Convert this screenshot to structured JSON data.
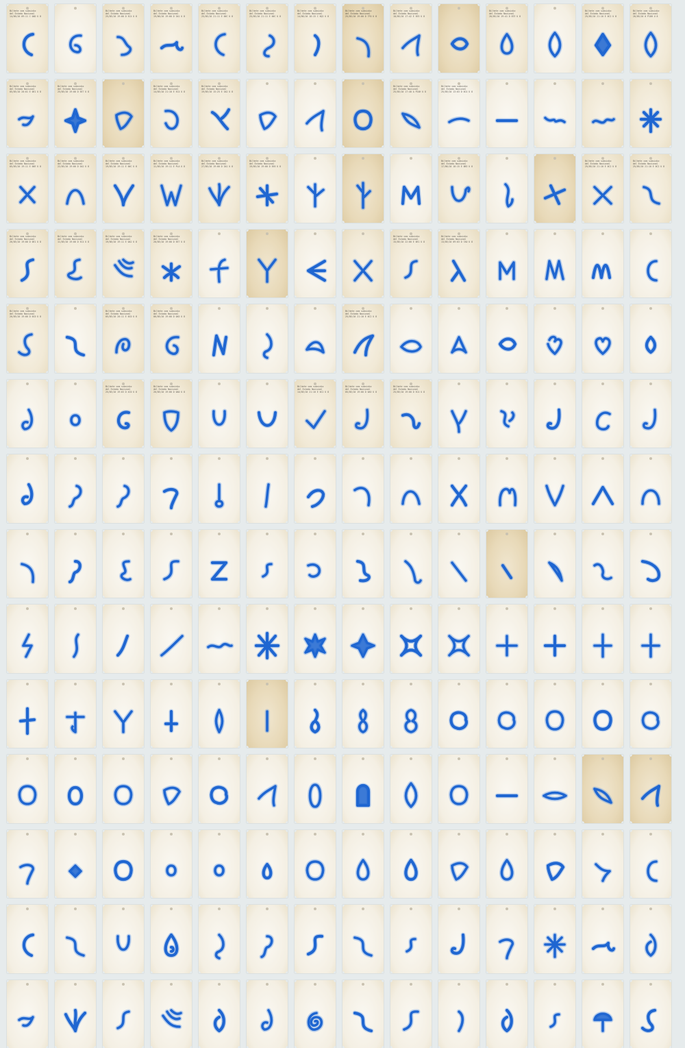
{
  "palette": {
    "background": "#e6ebec",
    "ink": "#1f66d1",
    "ink_light": "#4a8ae6",
    "paper": "#f3ecdc"
  },
  "print": {
    "line1": "Bilhete com subsidio",
    "line2": "del Estado Nacional"
  },
  "layout": {
    "columns": 14,
    "rows": 14
  },
  "tickets": [
    {
      "l3": "14/06/10 09:11 C 0AD  U 8",
      "shape": "c-shape",
      "tone": "normal"
    },
    {
      "l3": "",
      "shape": "g-curl",
      "tone": "pale"
    },
    {
      "l3": "25/05/10 19:00 D 5C4  U 8",
      "shape": "wave-squiggle",
      "tone": "normal"
    },
    {
      "l3": "19/06/10 19:00 D 3A1  U 8",
      "shape": "bird",
      "tone": "normal"
    },
    {
      "l3": "25/05/10 21:11 E 00C  U 8",
      "shape": "c-shape",
      "tone": "normal"
    },
    {
      "l3": "25/05/10 21:11 E 00C  U 8",
      "shape": "hook",
      "tone": "normal"
    },
    {
      "l3": "14/06/10 18:15 C 6Q2  U 8",
      "shape": "seed",
      "tone": "normal"
    },
    {
      "l3": "25/05/10 19:00 D 7F0  U 8",
      "shape": "hook-down",
      "tone": "aged"
    },
    {
      "l3": "18/05/10 17:42 E 5E5  U 8",
      "shape": "fin",
      "tone": "normal"
    },
    {
      "l3": "",
      "shape": "blob-wide",
      "tone": "aged"
    },
    {
      "l3": "26/05/10 19:41 D 87E  U 8",
      "shape": "drop",
      "tone": "normal"
    },
    {
      "l3": "",
      "shape": "leaf",
      "tone": "pale"
    },
    {
      "l3": "25/05/10 21:10 E 0C2  U 8",
      "shape": "diamond",
      "tone": "normal"
    },
    {
      "l3": "26/05/10 0 P18H  U 8",
      "shape": "leaf",
      "tone": "normal"
    },
    {
      "l3": "05/05/10 20:01 E 0E1  U 8",
      "shape": "bird-small",
      "tone": "normal"
    },
    {
      "l3": "25/05/10 19:00 D 5E7  U 8",
      "shape": "star4",
      "tone": "normal"
    },
    {
      "l3": "",
      "shape": "blob-tri",
      "tone": "aged"
    },
    {
      "l3": "14/05/10 21:10 E 5C4  U 8",
      "shape": "ghost",
      "tone": "normal"
    },
    {
      "l3": "19/05/10 15:25 E 3A2  U 8",
      "shape": "bird-curl",
      "tone": "normal"
    },
    {
      "l3": "",
      "shape": "blob-tri",
      "tone": "pale"
    },
    {
      "l3": "",
      "shape": "fin",
      "tone": "pale"
    },
    {
      "l3": "",
      "shape": "blob-round",
      "tone": "aged"
    },
    {
      "l3": "25/05/10 17:40 A P24H  U 8",
      "shape": "fin-right",
      "tone": "normal"
    },
    {
      "l3": "25/05/10 13:03 D 0C4  U 8",
      "shape": "dash-curve",
      "tone": "pale"
    },
    {
      "l3": "",
      "shape": "dash-flat",
      "tone": "pale"
    },
    {
      "l3": "",
      "shape": "bow",
      "tone": "pale"
    },
    {
      "l3": "",
      "shape": "wave-flat",
      "tone": "normal"
    },
    {
      "l3": "",
      "shape": "star-burst",
      "tone": "normal"
    },
    {
      "l3": "05/05/10 19:11 E 00E  U 8",
      "shape": "x-blob",
      "tone": "normal"
    },
    {
      "l3": "22/05/10 19:00 D 5A2  U 8",
      "shape": "arch",
      "tone": "normal"
    },
    {
      "l3": "19/05/10 19:11 E 00C  U 8",
      "shape": "wing-v",
      "tone": "normal"
    },
    {
      "l3": "11/05/10 19:11 E PLA  U 8",
      "shape": "w-shape",
      "tone": "normal"
    },
    {
      "l3": "27/05/10 19:00 D 3A1  U 8",
      "shape": "wings-up",
      "tone": "normal"
    },
    {
      "l3": "19/05/10 19:00 D 5E6  U 8",
      "shape": "starfish",
      "tone": "normal"
    },
    {
      "l3": "",
      "shape": "branch",
      "tone": "pale"
    },
    {
      "l3": "",
      "shape": "branch-tall",
      "tone": "aged"
    },
    {
      "l3": "",
      "shape": "crown",
      "tone": "pale"
    },
    {
      "l3": "17/06/10 18:15 E 0B3  U 8",
      "shape": "u-hook",
      "tone": "normal"
    },
    {
      "l3": "",
      "shape": "hook-tall",
      "tone": "pale"
    },
    {
      "l3": "",
      "shape": "arrow-cross",
      "tone": "aged"
    },
    {
      "l3": "25/05/10 21:10 E 0C2  U 8",
      "shape": "x-cross",
      "tone": "normal"
    },
    {
      "l3": "25/05/10 21:10 E 0C2  U 8",
      "shape": "twist",
      "tone": "normal"
    },
    {
      "l3": "26/05/10 19:00 D 0E1  U 8",
      "shape": "s-curl",
      "tone": "normal"
    },
    {
      "l3": "11/05/10 19:00 D 5C4  U 8",
      "shape": "s-loop",
      "tone": "normal"
    },
    {
      "l3": "19/06/10 19:11 E 0A2  U 8",
      "shape": "claw",
      "tone": "normal"
    },
    {
      "l3": "20/05/10 19:00 D 5E7  U 8",
      "shape": "octopus",
      "tone": "normal"
    },
    {
      "l3": "",
      "shape": "f-shape",
      "tone": "pale"
    },
    {
      "l3": "",
      "shape": "y-branch",
      "tone": "aged"
    },
    {
      "l3": "",
      "shape": "arrow-left",
      "tone": "pale"
    },
    {
      "l3": "",
      "shape": "wings-x",
      "tone": "normal"
    },
    {
      "l3": "15/05/10 22:00 E 0E1  U 8",
      "shape": "s-hook",
      "tone": "normal"
    },
    {
      "l3": "13/05/10 09:03 D 7A0  U 8",
      "shape": "lambda",
      "tone": "normal"
    },
    {
      "l3": "",
      "shape": "m-shape",
      "tone": "pale"
    },
    {
      "l3": "",
      "shape": "n-double",
      "tone": "pale"
    },
    {
      "l3": "",
      "shape": "m-wave",
      "tone": "pale"
    },
    {
      "l3": "",
      "shape": "hook-c",
      "tone": "pale"
    },
    {
      "l3": "26/05/10 19:00 D 0C0  U 8",
      "shape": "swan",
      "tone": "normal"
    },
    {
      "l3": "",
      "shape": "wave-s",
      "tone": "pale"
    },
    {
      "l3": "05/05/10 20:11 E 0C0  U 8",
      "shape": "loop",
      "tone": "normal"
    },
    {
      "l3": "06/05/10 19:00 D 0A5  U 8",
      "shape": "spiral-c",
      "tone": "normal"
    },
    {
      "l3": "",
      "shape": "n-zig",
      "tone": "pale"
    },
    {
      "l3": "",
      "shape": "drop-tail",
      "tone": "pale"
    },
    {
      "l3": "",
      "shape": "foot",
      "tone": "pale"
    },
    {
      "l3": "25/05/10 21:10 E 0C2  U 8",
      "shape": "boomerang",
      "tone": "normal"
    },
    {
      "l3": "",
      "shape": "fish",
      "tone": "pale"
    },
    {
      "l3": "",
      "shape": "arrow-tip",
      "tone": "pale"
    },
    {
      "l3": "",
      "shape": "blob-wide",
      "tone": "pale"
    },
    {
      "l3": "",
      "shape": "blob-heart",
      "tone": "pale"
    },
    {
      "l3": "",
      "shape": "heart",
      "tone": "pale"
    },
    {
      "l3": "",
      "shape": "leaf-small",
      "tone": "pale"
    },
    {
      "l3": "",
      "shape": "drop-curl",
      "tone": "pale"
    },
    {
      "l3": "",
      "shape": "dot-round",
      "tone": "pale"
    },
    {
      "l3": "25/05/10 19:03 D 4C0  U 8",
      "shape": "blob-c",
      "tone": "normal"
    },
    {
      "l3": "26/05/10 19:00 D 0A0  U 8",
      "shape": "shield",
      "tone": "normal"
    },
    {
      "l3": "",
      "shape": "u-tall",
      "tone": "pale"
    },
    {
      "l3": "",
      "shape": "u-open",
      "tone": "pale"
    },
    {
      "l3": "14/05/10 21:10 E 0C2  U 8",
      "shape": "check",
      "tone": "normal"
    },
    {
      "l3": "05/05/10 19:00 D 0A5  U 8",
      "shape": "hook-j",
      "tone": "normal"
    },
    {
      "l3": "25/05/10 19:00 D 5C4  U 8",
      "shape": "bird-hook",
      "tone": "normal"
    },
    {
      "l3": "",
      "shape": "y-curve",
      "tone": "pale"
    },
    {
      "l3": "",
      "shape": "s-twin",
      "tone": "pale"
    },
    {
      "l3": "",
      "shape": "hook-j",
      "tone": "pale"
    },
    {
      "l3": "",
      "shape": "c-open",
      "tone": "pale"
    },
    {
      "l3": "",
      "shape": "hook-j",
      "tone": "pale"
    },
    {
      "l3": "",
      "shape": "drop-curl",
      "tone": "pale"
    },
    {
      "l3": "",
      "shape": "comma",
      "tone": "pale"
    },
    {
      "l3": "",
      "shape": "comma",
      "tone": "pale"
    },
    {
      "l3": "",
      "shape": "fin-tail",
      "tone": "pale"
    },
    {
      "l3": "",
      "shape": "drop-stem",
      "tone": "pale"
    },
    {
      "l3": "",
      "shape": "stick",
      "tone": "pale"
    },
    {
      "l3": "",
      "shape": "hook-r",
      "tone": "pale"
    },
    {
      "l3": "",
      "shape": "hook-arc",
      "tone": "pale"
    },
    {
      "l3": "",
      "shape": "n-arch",
      "tone": "pale"
    },
    {
      "l3": "",
      "shape": "x-curve",
      "tone": "pale"
    },
    {
      "l3": "",
      "shape": "loop-arch",
      "tone": "pale"
    },
    {
      "l3": "",
      "shape": "v-wing",
      "tone": "pale"
    },
    {
      "l3": "",
      "shape": "chevron",
      "tone": "pale"
    },
    {
      "l3": "",
      "shape": "u-arch",
      "tone": "pale"
    },
    {
      "l3": "",
      "shape": "hook-down",
      "tone": "pale"
    },
    {
      "l3": "",
      "shape": "tadpole",
      "tone": "pale"
    },
    {
      "l3": "",
      "shape": "s-ribbon",
      "tone": "pale"
    },
    {
      "l3": "",
      "shape": "s-letter",
      "tone": "pale"
    },
    {
      "l3": "",
      "shape": "z-letter",
      "tone": "pale"
    },
    {
      "l3": "",
      "shape": "s-small",
      "tone": "pale"
    },
    {
      "l3": "",
      "shape": "fin-curl",
      "tone": "pale"
    },
    {
      "l3": "",
      "shape": "s-knot",
      "tone": "pale"
    },
    {
      "l3": "",
      "shape": "stick-tail",
      "tone": "pale"
    },
    {
      "l3": "",
      "shape": "slash",
      "tone": "pale"
    },
    {
      "l3": "",
      "shape": "slash-short",
      "tone": "aged"
    },
    {
      "l3": "",
      "shape": "thorn",
      "tone": "pale"
    },
    {
      "l3": "",
      "shape": "wave-thin",
      "tone": "pale"
    },
    {
      "l3": "",
      "shape": "hook-swoop",
      "tone": "pale"
    },
    {
      "l3": "",
      "shape": "lightning",
      "tone": "pale"
    },
    {
      "l3": "",
      "shape": "s-line",
      "tone": "pale"
    },
    {
      "l3": "",
      "shape": "stick-curve",
      "tone": "pale"
    },
    {
      "l3": "",
      "shape": "long-arc",
      "tone": "pale"
    },
    {
      "l3": "",
      "shape": "wave-long",
      "tone": "pale"
    },
    {
      "l3": "",
      "shape": "spike-star",
      "tone": "pale"
    },
    {
      "l3": "",
      "shape": "star8",
      "tone": "pale"
    },
    {
      "l3": "",
      "shape": "star-fat",
      "tone": "pale"
    },
    {
      "l3": "",
      "shape": "star-concave",
      "tone": "pale"
    },
    {
      "l3": "",
      "shape": "star-concave",
      "tone": "pale"
    },
    {
      "l3": "",
      "shape": "plus-round",
      "tone": "pale"
    },
    {
      "l3": "",
      "shape": "plus-round",
      "tone": "pale"
    },
    {
      "l3": "",
      "shape": "plus-thin",
      "tone": "pale"
    },
    {
      "l3": "",
      "shape": "plus-thin",
      "tone": "pale"
    },
    {
      "l3": "",
      "shape": "dagger",
      "tone": "pale"
    },
    {
      "l3": "",
      "shape": "figure",
      "tone": "pale"
    },
    {
      "l3": "",
      "shape": "y-letter",
      "tone": "pale"
    },
    {
      "l3": "",
      "shape": "dagger-small",
      "tone": "pale"
    },
    {
      "l3": "",
      "shape": "spindle",
      "tone": "pale"
    },
    {
      "l3": "",
      "shape": "stick-i",
      "tone": "aged"
    },
    {
      "l3": "",
      "shape": "drop-waist",
      "tone": "pale"
    },
    {
      "l3": "",
      "shape": "peanut",
      "tone": "pale"
    },
    {
      "l3": "",
      "shape": "gourd",
      "tone": "pale"
    },
    {
      "l3": "",
      "shape": "blob-lumpy",
      "tone": "pale"
    },
    {
      "l3": "",
      "shape": "blob-lumpy",
      "tone": "pale"
    },
    {
      "l3": "",
      "shape": "blob-round",
      "tone": "pale"
    },
    {
      "l3": "",
      "shape": "blob-round",
      "tone": "pale"
    },
    {
      "l3": "",
      "shape": "blob-lumpy",
      "tone": "pale"
    },
    {
      "l3": "",
      "shape": "blob-round",
      "tone": "pale"
    },
    {
      "l3": "",
      "shape": "oval",
      "tone": "pale"
    },
    {
      "l3": "",
      "shape": "blob-round",
      "tone": "pale"
    },
    {
      "l3": "",
      "shape": "blob-tri",
      "tone": "pale"
    },
    {
      "l3": "",
      "shape": "blob-lumpy",
      "tone": "pale"
    },
    {
      "l3": "",
      "shape": "fin",
      "tone": "pale"
    },
    {
      "l3": "",
      "shape": "oval-tall",
      "tone": "pale"
    },
    {
      "l3": "",
      "shape": "tombstone",
      "tone": "pale"
    },
    {
      "l3": "",
      "shape": "leaf",
      "tone": "pale"
    },
    {
      "l3": "",
      "shape": "blob-round",
      "tone": "pale"
    },
    {
      "l3": "",
      "shape": "dash-flat",
      "tone": "pale"
    },
    {
      "l3": "",
      "shape": "spindle-flat",
      "tone": "pale"
    },
    {
      "l3": "",
      "shape": "fin-right",
      "tone": "aged"
    },
    {
      "l3": "",
      "shape": "fin",
      "tone": "aged"
    },
    {
      "l3": "",
      "shape": "fin-tail",
      "tone": "pale"
    },
    {
      "l3": "",
      "shape": "diamond-small",
      "tone": "pale"
    },
    {
      "l3": "",
      "shape": "blob-round",
      "tone": "pale"
    },
    {
      "l3": "",
      "shape": "dot-round",
      "tone": "pale"
    },
    {
      "l3": "",
      "shape": "dot-round",
      "tone": "pale"
    },
    {
      "l3": "",
      "shape": "drop-small",
      "tone": "pale"
    },
    {
      "l3": "",
      "shape": "blob-round",
      "tone": "pale"
    },
    {
      "l3": "",
      "shape": "drop",
      "tone": "pale"
    },
    {
      "l3": "",
      "shape": "drop",
      "tone": "pale"
    },
    {
      "l3": "",
      "shape": "blob-tri",
      "tone": "pale"
    },
    {
      "l3": "",
      "shape": "drop",
      "tone": "pale"
    },
    {
      "l3": "",
      "shape": "blob-tri",
      "tone": "pale"
    },
    {
      "l3": "",
      "shape": "claw-small",
      "tone": "pale"
    },
    {
      "l3": "",
      "shape": "hook-c",
      "tone": "pale"
    },
    {
      "l3": "",
      "shape": "c-shape",
      "tone": "pale"
    },
    {
      "l3": "",
      "shape": "wave-s",
      "tone": "pale"
    },
    {
      "l3": "",
      "shape": "u-tall",
      "tone": "pale"
    },
    {
      "l3": "",
      "shape": "drop-loop",
      "tone": "pale"
    },
    {
      "l3": "",
      "shape": "drop-tail",
      "tone": "pale"
    },
    {
      "l3": "",
      "shape": "tadpole",
      "tone": "pale"
    },
    {
      "l3": "",
      "shape": "s-letter",
      "tone": "pale"
    },
    {
      "l3": "",
      "shape": "wave-s",
      "tone": "pale"
    },
    {
      "l3": "",
      "shape": "s-small",
      "tone": "pale"
    },
    {
      "l3": "",
      "shape": "hook-j",
      "tone": "pale"
    },
    {
      "l3": "",
      "shape": "fin-tail",
      "tone": "pale"
    },
    {
      "l3": "",
      "shape": "star-burst",
      "tone": "pale"
    },
    {
      "l3": "",
      "shape": "bird",
      "tone": "pale"
    },
    {
      "l3": "",
      "shape": "flame",
      "tone": "pale"
    },
    {
      "l3": "",
      "shape": "bird-small",
      "tone": "pale"
    },
    {
      "l3": "",
      "shape": "wings-up",
      "tone": "pale"
    },
    {
      "l3": "",
      "shape": "s-hook",
      "tone": "pale"
    },
    {
      "l3": "",
      "shape": "claw",
      "tone": "pale"
    },
    {
      "l3": "",
      "shape": "flame",
      "tone": "pale"
    },
    {
      "l3": "",
      "shape": "drop-curl",
      "tone": "pale"
    },
    {
      "l3": "",
      "shape": "spiral",
      "tone": "pale"
    },
    {
      "l3": "",
      "shape": "wave-s",
      "tone": "pale"
    },
    {
      "l3": "",
      "shape": "s-letter",
      "tone": "pale"
    },
    {
      "l3": "",
      "shape": "seed",
      "tone": "pale"
    },
    {
      "l3": "",
      "shape": "flame",
      "tone": "pale"
    },
    {
      "l3": "",
      "shape": "s-small",
      "tone": "pale"
    },
    {
      "l3": "",
      "shape": "mushroom",
      "tone": "pale"
    },
    {
      "l3": "",
      "shape": "swan",
      "tone": "pale"
    }
  ]
}
